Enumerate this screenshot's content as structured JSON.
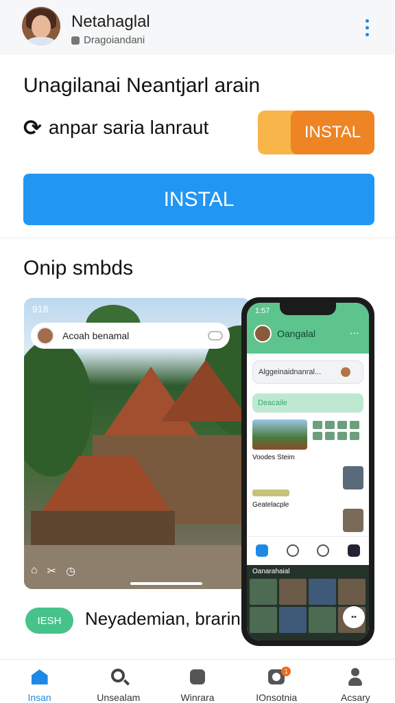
{
  "header": {
    "user_name": "Netahaglal",
    "user_subtitle": "Dragoiandani"
  },
  "app": {
    "title": "Unagilanai Neantjarl arain",
    "sync_text": "anpar saria lanraut",
    "install_small_label": "INSTAL",
    "install_big_label": "INSTAL"
  },
  "section": {
    "title": "Onip smbds"
  },
  "screenshot1": {
    "status_time": "918",
    "notification_text": "Acoah benamal"
  },
  "phone": {
    "status_time": "1:57",
    "contact_name": "Oangalal",
    "search_text": "Alggeinaidnanral...",
    "green_bar_text": "Deacaile",
    "label1": "Voodes Steim",
    "label2": "Geatelacple",
    "gallery_title": "Oanarahaial",
    "play_label": "••"
  },
  "bottom": {
    "tag": "IESH",
    "text": "Neyademian, brarin"
  },
  "tabs": [
    {
      "label": "Insan"
    },
    {
      "label": "Unsealam"
    },
    {
      "label": "Winrara"
    },
    {
      "label": "IOnsotnia"
    },
    {
      "label": "Acsary"
    }
  ],
  "colors": {
    "accent_blue": "#2196f3",
    "install_orange": "#ee8424",
    "install_orange_light": "#f7b54a",
    "tag_green": "#47c28a",
    "phone_header_green": "#5ec48e"
  },
  "icons": [
    "kebab-menu-icon",
    "sync-icon",
    "home-icon",
    "search-icon",
    "puzzle-icon",
    "chat-icon",
    "person-icon"
  ]
}
